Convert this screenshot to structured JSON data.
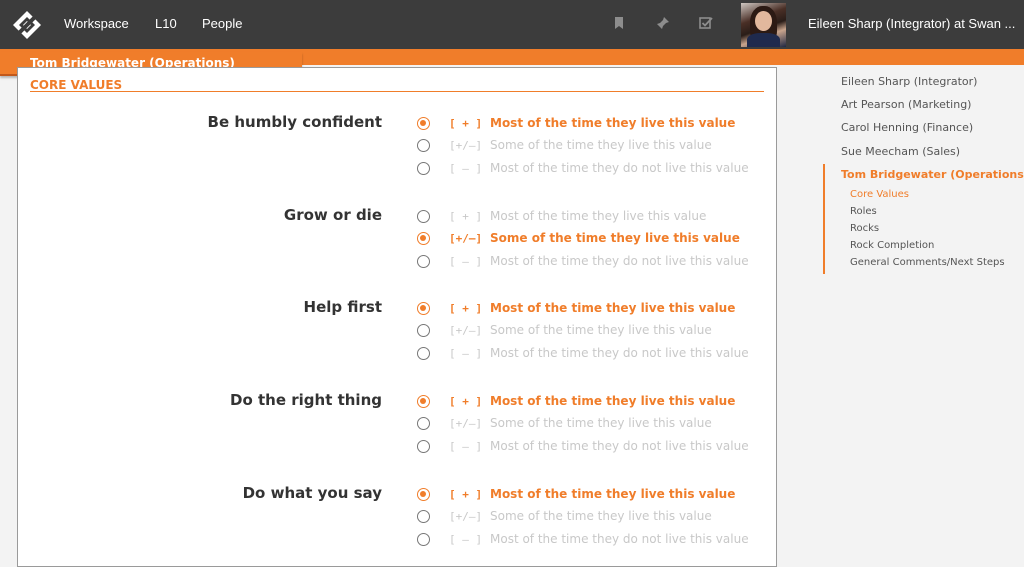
{
  "nav": {
    "workspace": "Workspace",
    "l10": "L10",
    "people": "People",
    "user_label": "Eileen Sharp (Integrator) at Swan ..."
  },
  "icons": {
    "logo": "eos-logo-icon",
    "bookmark": "bookmark-icon",
    "pin": "pin-icon",
    "todo": "checkbox-icon"
  },
  "colors": {
    "accent": "#f07d2a",
    "topbar": "#3c3c3c"
  },
  "person_tab": "Tom Bridgewater (Operations)",
  "section_title": "CORE VALUES",
  "options": [
    {
      "sym": "[ + ]",
      "text": "Most of the time they live this value"
    },
    {
      "sym": "[+/–]",
      "text": "Some of the time they live this value"
    },
    {
      "sym": "[ – ]",
      "text": "Most of the time they do not live this value"
    }
  ],
  "values": [
    {
      "name": "Be humbly confident",
      "selected": 0
    },
    {
      "name": "Grow or die",
      "selected": 1
    },
    {
      "name": "Help first",
      "selected": 0
    },
    {
      "name": "Do the right thing",
      "selected": 0
    },
    {
      "name": "Do what you say",
      "selected": 0
    }
  ],
  "sidebar": {
    "people": [
      "Eileen Sharp (Integrator)",
      "Art Pearson (Marketing)",
      "Carol Henning (Finance)",
      "Sue Meecham (Sales)",
      "Tom Bridgewater (Operations)"
    ],
    "active_person": 4,
    "sections": [
      "Core Values",
      "Roles",
      "Rocks",
      "Rock Completion",
      "General Comments/Next Steps"
    ],
    "active_section": 0
  }
}
